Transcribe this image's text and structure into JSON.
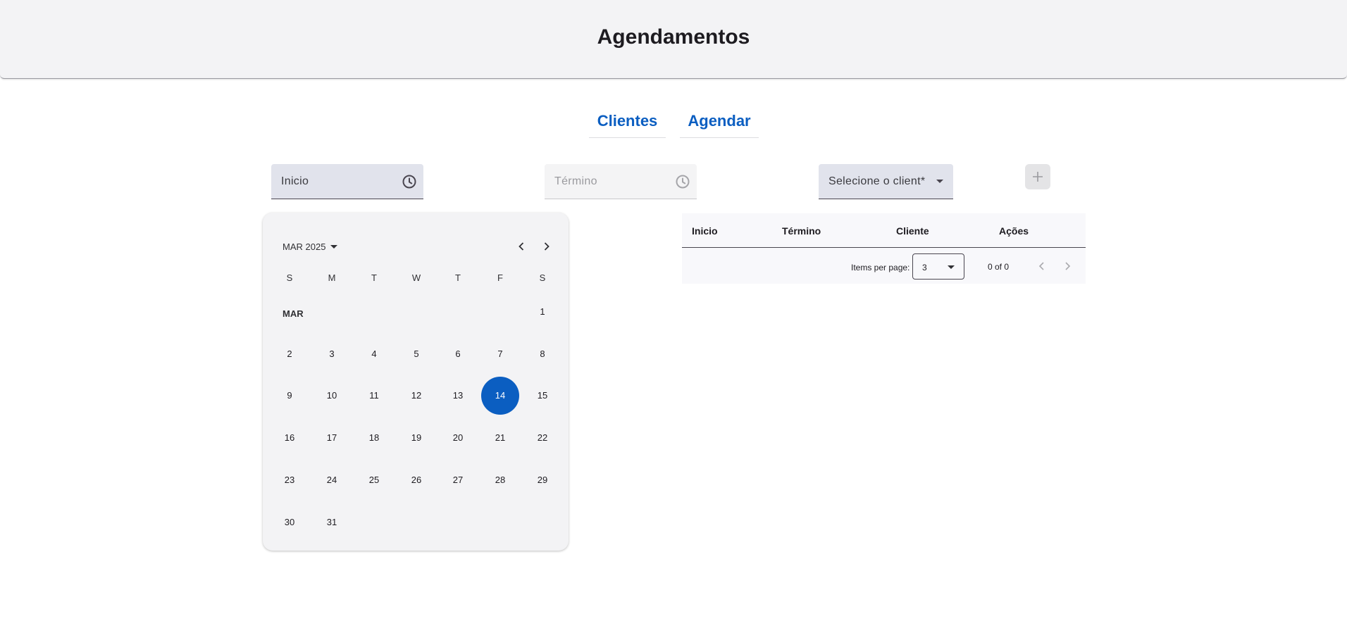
{
  "header": {
    "title": "Agendamentos"
  },
  "nav": {
    "clientes": "Clientes",
    "agendar": "Agendar"
  },
  "form": {
    "inicio_label": "Inicio",
    "termino_label": "Término",
    "client_label": "Selecione o client*",
    "add_icon": "plus-icon"
  },
  "calendar": {
    "period": "MAR 2025",
    "month_label": "MAR",
    "weekdays": [
      "S",
      "M",
      "T",
      "W",
      "T",
      "F",
      "S"
    ],
    "selected_day": "14",
    "days": [
      "1",
      "2",
      "3",
      "4",
      "5",
      "6",
      "7",
      "8",
      "9",
      "10",
      "11",
      "12",
      "13",
      "14",
      "15",
      "16",
      "17",
      "18",
      "19",
      "20",
      "21",
      "22",
      "23",
      "24",
      "25",
      "26",
      "27",
      "28",
      "29",
      "30",
      "31"
    ],
    "first_weekday_index": 6
  },
  "table": {
    "columns": [
      "Inicio",
      "Término",
      "Cliente",
      "Ações"
    ],
    "rows": []
  },
  "paginator": {
    "items_per_page_label": "Items per page:",
    "page_size": "3",
    "range_label": "0 of 0"
  },
  "colors": {
    "primary": "#0b5ec1",
    "surface": "#f3f3f5",
    "field_fill": "#e1e3ec"
  }
}
